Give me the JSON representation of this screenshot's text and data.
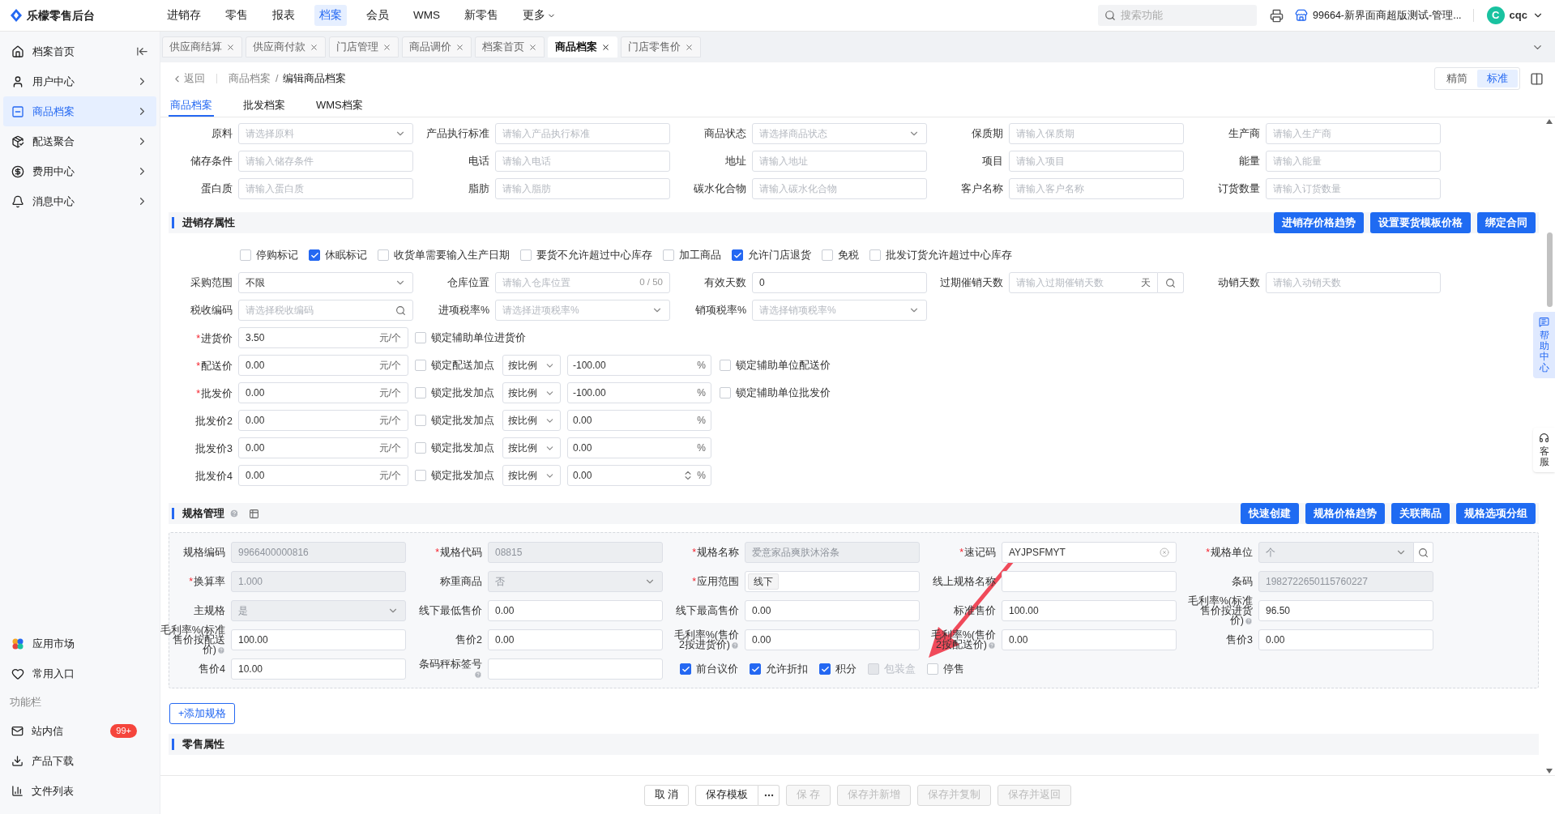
{
  "required_mark": "*",
  "topbar": {
    "logo": "乐檬零售后台",
    "menu": [
      {
        "label": "进销存",
        "selected": false,
        "dropdown": false
      },
      {
        "label": "零售",
        "selected": false,
        "dropdown": false
      },
      {
        "label": "报表",
        "selected": false,
        "dropdown": false
      },
      {
        "label": "档案",
        "selected": true,
        "dropdown": false
      },
      {
        "label": "会员",
        "selected": false,
        "dropdown": false
      },
      {
        "label": "WMS",
        "selected": false,
        "dropdown": false
      },
      {
        "label": "新零售",
        "selected": false,
        "dropdown": false
      },
      {
        "label": "更多",
        "selected": false,
        "dropdown": true
      }
    ],
    "search": {
      "placeholder": "搜索功能"
    },
    "store": "99664-新界面商超版测试-管理...",
    "user": {
      "avatar": "C",
      "name": "cqc"
    }
  },
  "sidebar": {
    "items": [
      {
        "label": "档案首页",
        "selected": false
      },
      {
        "label": "用户中心",
        "selected": false
      },
      {
        "label": "商品档案",
        "selected": true
      },
      {
        "label": "配送聚合",
        "selected": false
      },
      {
        "label": "费用中心",
        "selected": false
      },
      {
        "label": "消息中心",
        "selected": false
      }
    ],
    "shortcuts": [
      {
        "label": "应用市场"
      },
      {
        "label": "常用入口"
      }
    ],
    "section": "功能栏",
    "tools": [
      {
        "label": "站内信",
        "badge": "99+"
      },
      {
        "label": "产品下载"
      },
      {
        "label": "文件列表"
      }
    ]
  },
  "tabs": [
    {
      "label": "供应商结算",
      "selected": false
    },
    {
      "label": "供应商付款",
      "selected": false
    },
    {
      "label": "门店管理",
      "selected": false
    },
    {
      "label": "商品调价",
      "selected": false
    },
    {
      "label": "档案首页",
      "selected": false
    },
    {
      "label": "商品档案",
      "selected": true
    },
    {
      "label": "门店零售价",
      "selected": false
    }
  ],
  "breadcrumb": {
    "back": "返回",
    "parent": "商品档案",
    "separator": "/",
    "current": "编辑商品档案"
  },
  "view_toggle": [
    {
      "label": "精简",
      "selected": false
    },
    {
      "label": "标准",
      "selected": true
    }
  ],
  "sub_tabs": [
    {
      "label": "商品档案",
      "selected": true
    },
    {
      "label": "批发档案",
      "selected": false
    },
    {
      "label": "WMS档案",
      "selected": false
    }
  ],
  "basic_fields": [
    {
      "label": "原料",
      "kind": "select",
      "placeholder": "请选择原料"
    },
    {
      "label": "产品执行标准",
      "kind": "input",
      "placeholder": "请输入产品执行标准"
    },
    {
      "label": "商品状态",
      "kind": "select",
      "placeholder": "请选择商品状态"
    },
    {
      "label": "保质期",
      "kind": "input",
      "placeholder": "请输入保质期"
    },
    {
      "label": "生产商",
      "kind": "input",
      "placeholder": "请输入生产商"
    },
    {
      "label": "储存条件",
      "kind": "input",
      "placeholder": "请输入储存条件"
    },
    {
      "label": "电话",
      "kind": "input",
      "placeholder": "请输入电话"
    },
    {
      "label": "地址",
      "kind": "input",
      "placeholder": "请输入地址"
    },
    {
      "label": "项目",
      "kind": "input",
      "placeholder": "请输入项目"
    },
    {
      "label": "能量",
      "kind": "input",
      "placeholder": "请输入能量"
    },
    {
      "label": "蛋白质",
      "kind": "input",
      "placeholder": "请输入蛋白质"
    },
    {
      "label": "脂肪",
      "kind": "input",
      "placeholder": "请输入脂肪"
    },
    {
      "label": "碳水化合物",
      "kind": "input",
      "placeholder": "请输入碳水化合物"
    },
    {
      "label": "客户名称",
      "kind": "input",
      "placeholder": "请输入客户名称"
    },
    {
      "label": "订货数量",
      "kind": "input",
      "placeholder": "请输入订货数量"
    }
  ],
  "stock_section": {
    "title": "进销存属性",
    "buttons": [
      "进销存价格趋势",
      "设置要货模板价格",
      "绑定合同"
    ],
    "flags": [
      {
        "label": "停购标记",
        "checked": false
      },
      {
        "label": "休眠标记",
        "checked": true
      },
      {
        "label": "收货单需要输入生产日期",
        "checked": false
      },
      {
        "label": "要货不允许超过中心库存",
        "checked": false
      },
      {
        "label": "加工商品",
        "checked": false
      },
      {
        "label": "允许门店退货",
        "checked": true
      },
      {
        "label": "免税",
        "checked": false
      },
      {
        "label": "批发订货允许超过中心库存",
        "checked": false
      }
    ],
    "fields": [
      {
        "label": "采购范围",
        "kind": "select",
        "value": "不限"
      },
      {
        "label": "仓库位置",
        "kind": "counter",
        "placeholder": "请输入仓库位置",
        "counter": "0 / 50"
      },
      {
        "label": "有效天数",
        "kind": "input",
        "value": "0"
      },
      {
        "label": "过期催销天数",
        "kind": "suffix_search",
        "placeholder": "请输入过期催销天数",
        "suffix": "天"
      },
      {
        "label": "动销天数",
        "kind": "input",
        "placeholder": "请输入动销天数"
      },
      {
        "label": "税收编码",
        "kind": "search",
        "placeholder": "请选择税收编码"
      },
      {
        "label": "进项税率%",
        "kind": "select",
        "placeholder": "请选择进项税率%"
      },
      {
        "label": "销项税率%",
        "kind": "select",
        "placeholder": "请选择销项税率%"
      }
    ],
    "prices": [
      {
        "label": "进货价",
        "required": true,
        "value": "3.50",
        "unit": "元/个",
        "lock": {
          "label": "锁定辅助单位进货价",
          "checked": false
        }
      },
      {
        "label": "配送价",
        "required": true,
        "value": "0.00",
        "unit": "元/个",
        "lock": {
          "label": "锁定配送加点",
          "checked": false
        },
        "mode": "按比例",
        "markup": "-100.00",
        "markup_unit": "%",
        "spinner": false,
        "aux_lock": {
          "label": "锁定辅助单位配送价",
          "checked": false
        }
      },
      {
        "label": "批发价",
        "required": true,
        "value": "0.00",
        "unit": "元/个",
        "lock": {
          "label": "锁定批发加点",
          "checked": false
        },
        "mode": "按比例",
        "markup": "-100.00",
        "markup_unit": "%",
        "spinner": false,
        "aux_lock": {
          "label": "锁定辅助单位批发价",
          "checked": false
        }
      },
      {
        "label": "批发价2",
        "required": false,
        "value": "0.00",
        "unit": "元/个",
        "lock": {
          "label": "锁定批发加点",
          "checked": false
        },
        "mode": "按比例",
        "markup": "0.00",
        "markup_unit": "%",
        "spinner": false
      },
      {
        "label": "批发价3",
        "required": false,
        "value": "0.00",
        "unit": "元/个",
        "lock": {
          "label": "锁定批发加点",
          "checked": false
        },
        "mode": "按比例",
        "markup": "0.00",
        "markup_unit": "%",
        "spinner": false
      },
      {
        "label": "批发价4",
        "required": false,
        "value": "0.00",
        "unit": "元/个",
        "lock": {
          "label": "锁定批发加点",
          "checked": false
        },
        "mode": "按比例",
        "markup": "0.00",
        "markup_unit": "%",
        "spinner": true
      }
    ]
  },
  "spec_section": {
    "title": "规格管理",
    "buttons": [
      "快速创建",
      "规格价格趋势",
      "关联商品",
      "规格选项分组"
    ],
    "fields": [
      {
        "label": "规格编码",
        "required": false,
        "kind": "input",
        "value": "9966400000816",
        "disabled": true,
        "help": false
      },
      {
        "label": "规格代码",
        "required": true,
        "kind": "input",
        "value": "08815",
        "disabled": true,
        "help": false
      },
      {
        "label": "规格名称",
        "required": true,
        "kind": "input",
        "value": "爱意家品爽肤沐浴条",
        "disabled": true,
        "help": false
      },
      {
        "label": "速记码",
        "required": true,
        "kind": "clear",
        "value": "AYJPSFMYT",
        "disabled": false,
        "help": false
      },
      {
        "label": "规格单位",
        "required": true,
        "kind": "select_search",
        "value": "个",
        "disabled": true,
        "help": false
      },
      {
        "label": "换算率",
        "required": true,
        "kind": "input",
        "value": "1.000",
        "disabled": true,
        "help": false
      },
      {
        "label": "称重商品",
        "required": false,
        "kind": "select",
        "value": "否",
        "disabled": true,
        "help": false
      },
      {
        "label": "应用范围",
        "required": true,
        "kind": "tag",
        "value": "线下",
        "disabled": false,
        "help": false
      },
      {
        "label": "线上规格名称",
        "required": false,
        "kind": "input",
        "disabled": false,
        "help": false
      },
      {
        "label": "条码",
        "required": false,
        "kind": "input",
        "value": "1982722650115760227",
        "disabled": true,
        "help": false
      },
      {
        "label": "主规格",
        "required": false,
        "kind": "select",
        "value": "是",
        "disabled": true,
        "help": false
      },
      {
        "label": "线下最低售价",
        "required": false,
        "kind": "input",
        "value": "0.00",
        "disabled": false,
        "help": false
      },
      {
        "label": "线下最高售价",
        "required": false,
        "kind": "input",
        "value": "0.00",
        "disabled": false,
        "help": false
      },
      {
        "label": "标准售价",
        "required": false,
        "kind": "input",
        "value": "100.00",
        "disabled": false,
        "help": false
      },
      {
        "label": "毛利率%(标准售价按进货价)",
        "required": false,
        "kind": "input",
        "value": "96.50",
        "disabled": false,
        "help": true
      },
      {
        "label": "毛利率%(标准售价按配送价)",
        "required": false,
        "kind": "input",
        "value": "100.00",
        "disabled": false,
        "help": true
      },
      {
        "label": "售价2",
        "required": false,
        "kind": "input",
        "value": "0.00",
        "disabled": false,
        "help": false
      },
      {
        "label": "毛利率%(售价2按进货价)",
        "required": false,
        "kind": "input",
        "value": "0.00",
        "disabled": false,
        "help": true
      },
      {
        "label": "毛利率%(售价2按配送价)",
        "required": false,
        "kind": "input",
        "value": "0.00",
        "disabled": false,
        "help": true
      },
      {
        "label": "售价3",
        "required": false,
        "kind": "input",
        "value": "0.00",
        "disabled": false,
        "help": false
      },
      {
        "label": "售价4",
        "required": false,
        "kind": "input",
        "value": "10.00",
        "disabled": false,
        "help": false
      },
      {
        "label": "条码秤标签号",
        "required": false,
        "kind": "input",
        "disabled": false,
        "help": true
      }
    ],
    "flags": [
      {
        "label": "前台议价",
        "checked": true,
        "disabled": false
      },
      {
        "label": "允许折扣",
        "checked": true,
        "disabled": false
      },
      {
        "label": "积分",
        "checked": true,
        "disabled": false
      },
      {
        "label": "包装盒",
        "checked": false,
        "disabled": true
      },
      {
        "label": "停售",
        "checked": false,
        "disabled": false
      }
    ]
  },
  "add_spec": "+添加规格",
  "retail_section": {
    "title": "零售属性"
  },
  "footer": [
    {
      "label": "取 消",
      "disabled": false,
      "split": false
    },
    {
      "label": "保存模板",
      "disabled": false,
      "split": true
    },
    {
      "label": "保 存",
      "disabled": true,
      "split": false
    },
    {
      "label": "保存并新增",
      "disabled": true,
      "split": false
    },
    {
      "label": "保存并复制",
      "disabled": true,
      "split": false
    },
    {
      "label": "保存并返回",
      "disabled": true,
      "split": false
    }
  ],
  "side_help": {
    "help": "帮助中心",
    "service": "客服"
  }
}
